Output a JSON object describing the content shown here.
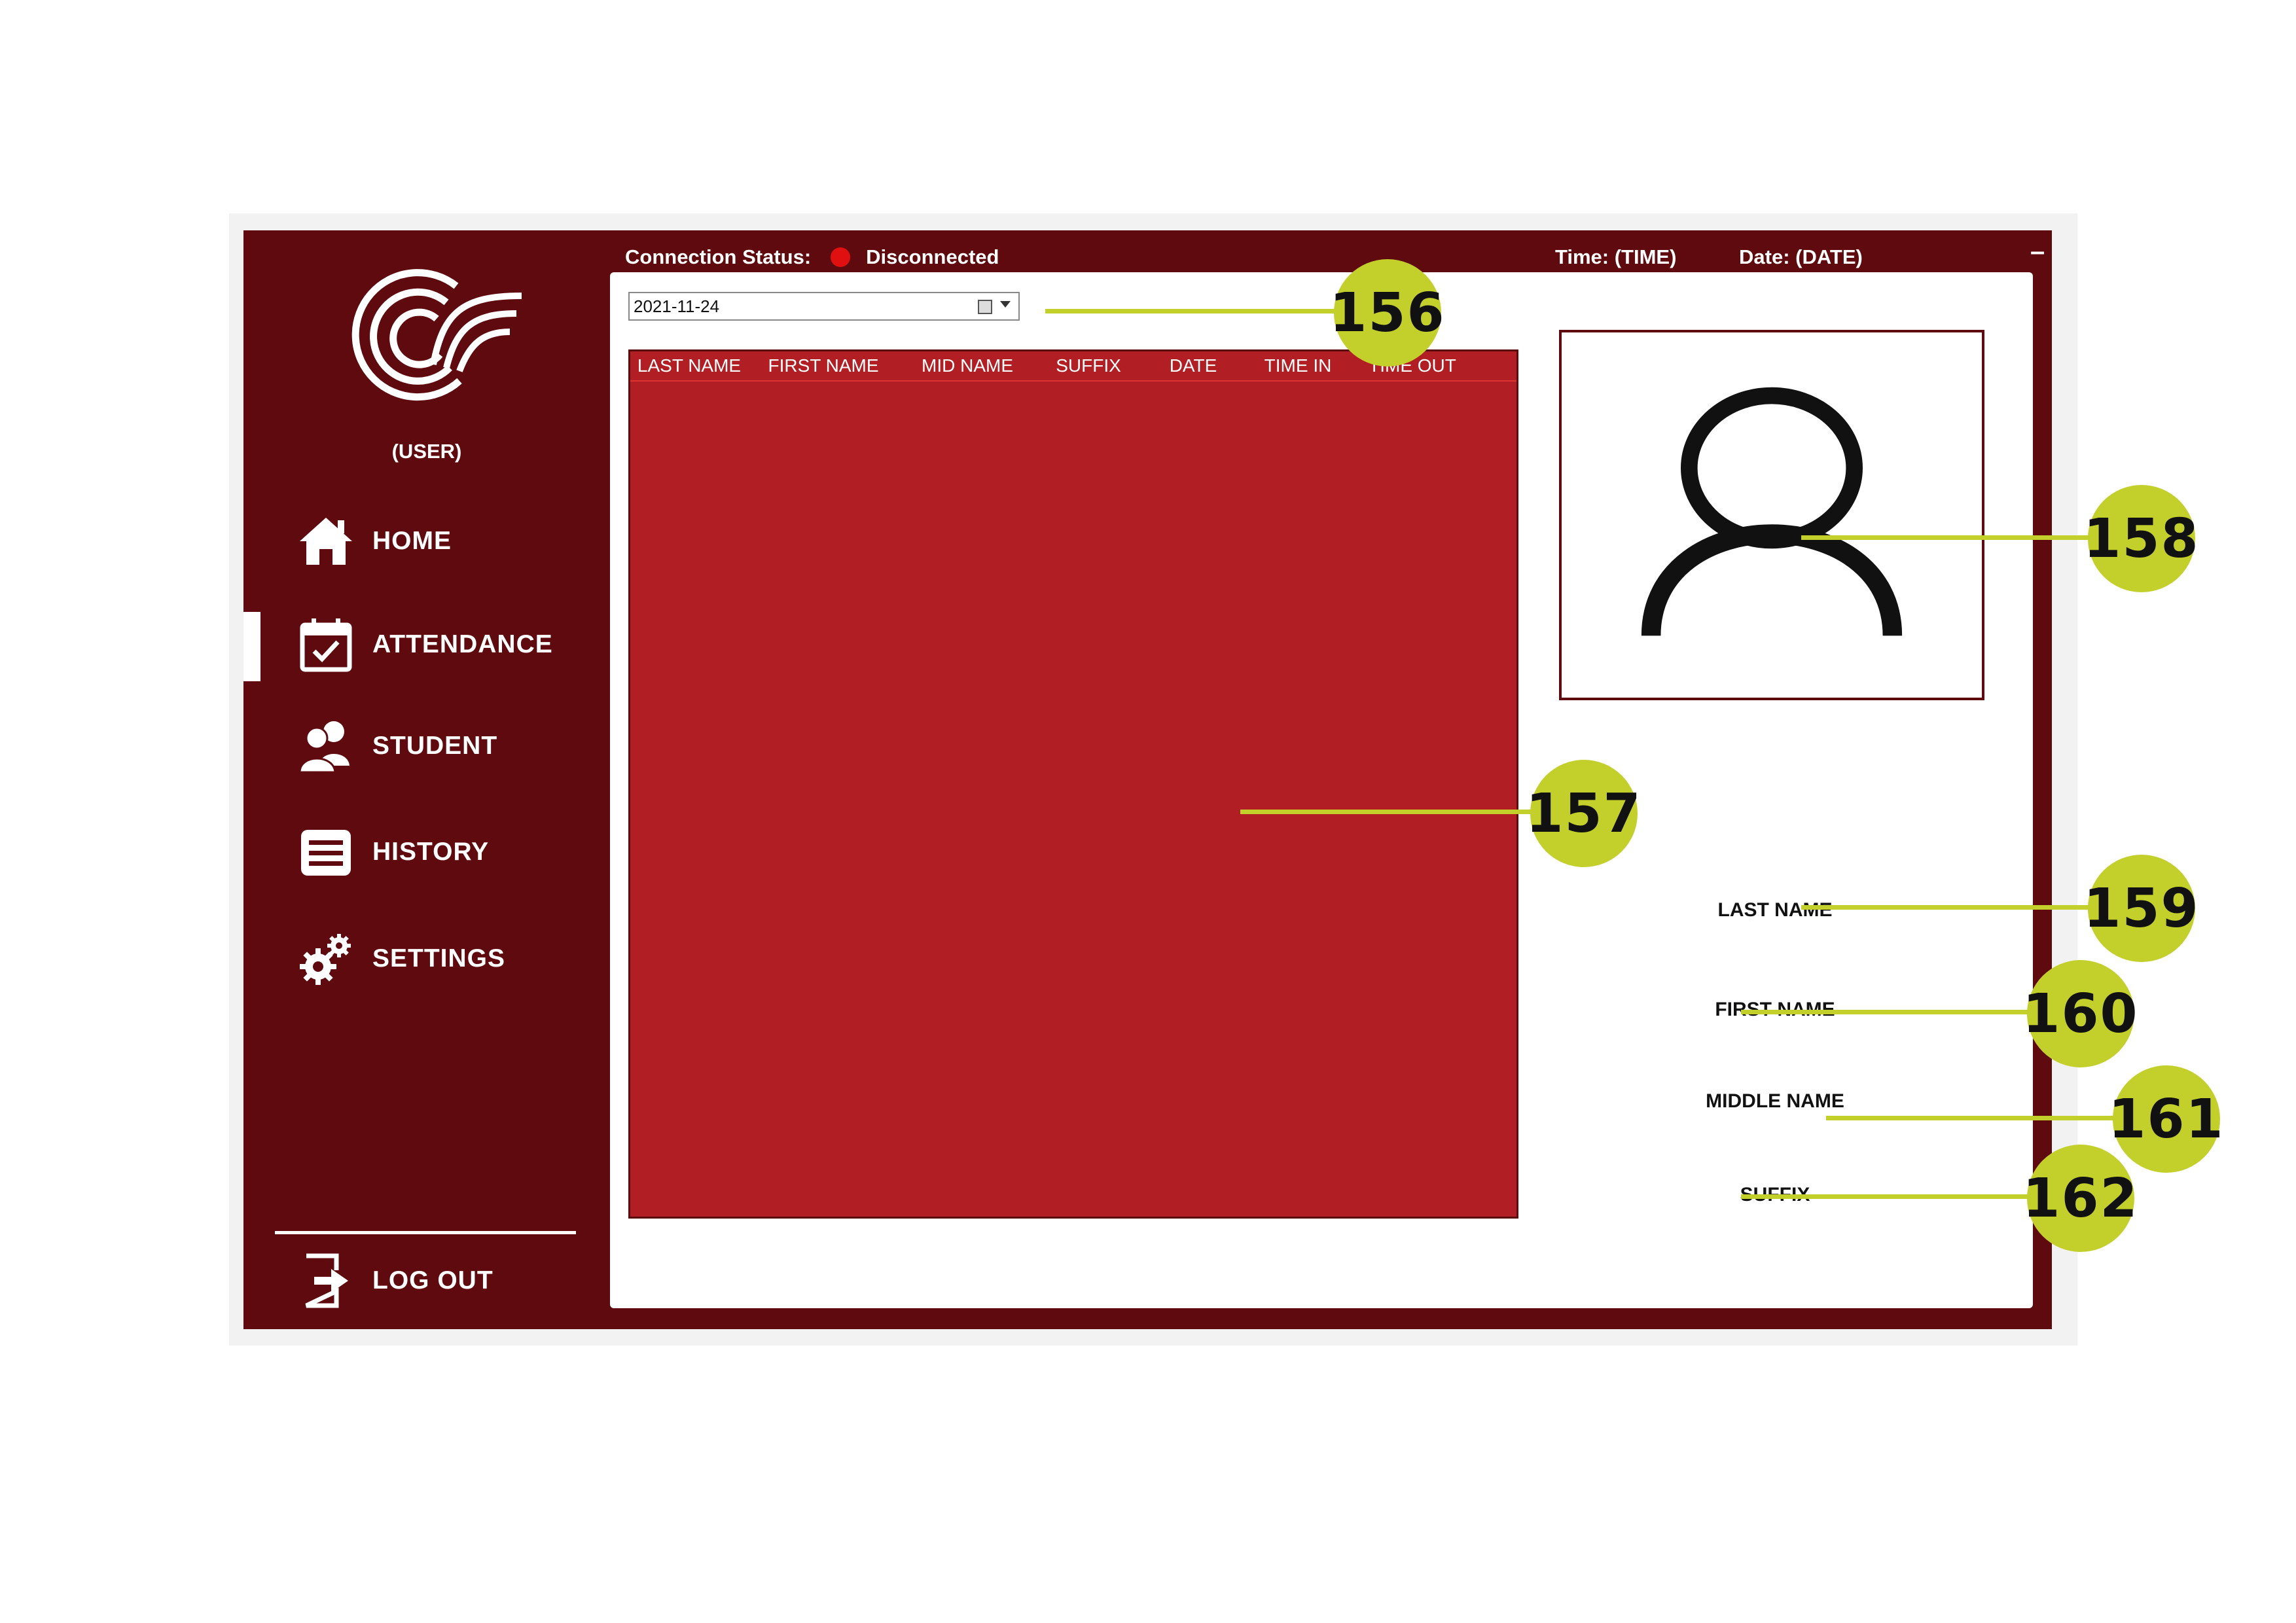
{
  "sidebar": {
    "user": "(USER)",
    "items": [
      {
        "label": "HOME",
        "icon": "home-icon"
      },
      {
        "label": "ATTENDANCE",
        "icon": "calendar-check-icon",
        "active": true
      },
      {
        "label": "STUDENT",
        "icon": "students-icon"
      },
      {
        "label": "HISTORY",
        "icon": "list-icon"
      },
      {
        "label": "SETTINGS",
        "icon": "gears-icon"
      }
    ],
    "logout": {
      "label": "LOG OUT",
      "icon": "logout-icon"
    }
  },
  "topbar": {
    "connection_label": "Connection Status:",
    "connection_status": "Disconnected",
    "status_color": "#e01010",
    "time": "Time: (TIME)",
    "date": "Date:  (DATE)",
    "minimize": "–"
  },
  "main": {
    "date_picker_value": "2021-11-24",
    "table": {
      "columns": [
        "LAST NAME",
        "FIRST NAME",
        "MID NAME",
        "SUFFIX",
        "DATE",
        "TIME IN",
        "TIME OUT"
      ],
      "rows": []
    },
    "fields": {
      "last_name": "LAST NAME",
      "first_name": "FIRST NAME",
      "middle_name": "MIDDLE NAME",
      "suffix": "SUFFIX"
    }
  },
  "callouts": [
    "156",
    "157",
    "158",
    "159",
    "160",
    "161",
    "162"
  ],
  "colors": {
    "sidebar_bg": "#5e0a0e",
    "table_bg": "#b11f24",
    "callout": "#c3cf2a"
  }
}
